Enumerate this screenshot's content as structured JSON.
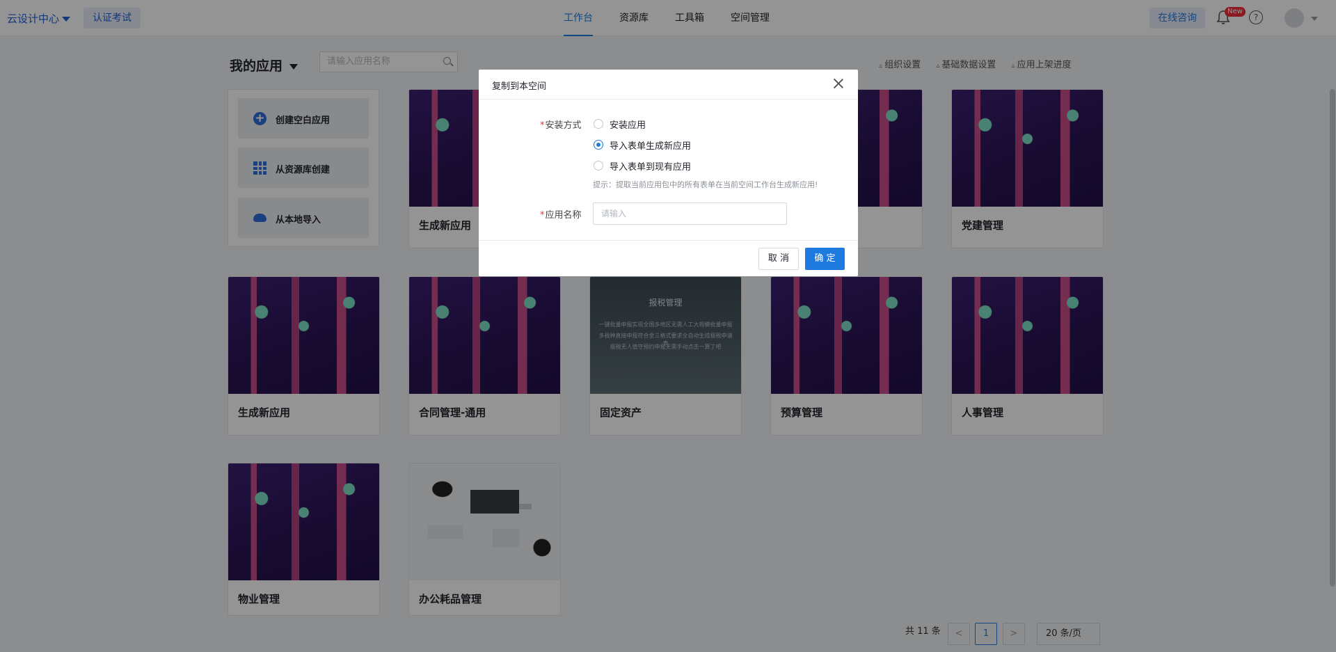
{
  "topbar": {
    "brand": "云设计中心",
    "cert": "认证考试",
    "tabs": [
      "工作台",
      "资源库",
      "工具箱",
      "空间管理"
    ],
    "consult": "在线咨询",
    "new_badge": "New",
    "help": "?"
  },
  "page": {
    "title": "我的应用",
    "search_placeholder": "请输入应用名称",
    "links": [
      "组织设置",
      "基础数据设置",
      "应用上架进度"
    ]
  },
  "create": {
    "blank": "创建空白应用",
    "from_library": "从资源库创建",
    "import_local": "从本地导入"
  },
  "apps": [
    {
      "name": "生成新应用",
      "image": "city"
    },
    {
      "name": "党建管理",
      "image": "city"
    },
    {
      "name": "生成新应用",
      "image": "city"
    },
    {
      "name": "合同管理-通用",
      "image": "city"
    },
    {
      "name": "固定资产",
      "image": "tax"
    },
    {
      "name": "预算管理",
      "image": "city"
    },
    {
      "name": "人事管理",
      "image": "city"
    },
    {
      "name": "物业管理",
      "image": "city"
    },
    {
      "name": "办公耗品管理",
      "image": "desk"
    }
  ],
  "tax_image": {
    "title": "报税管理",
    "line1": "一键批量申报实现全国多地区无需人工大规模批量申报",
    "line2": "多税种直接申报符合金三格式要求全自动生成报税申请表",
    "line3": "报税无人值守预约申报无需手动点击一算了吧"
  },
  "dialog": {
    "title": "复制到本空间",
    "install_label": "安装方式",
    "options": [
      "安装应用",
      "导入表单生成新应用",
      "导入表单到现有应用"
    ],
    "selected_index": 1,
    "hint": "提示：提取当前应用包中的所有表单在当前空间工作台生成新应用!",
    "name_label": "应用名称",
    "name_placeholder": "请输入",
    "cancel": "取 消",
    "ok": "确 定",
    "required_mark": "*"
  },
  "pagination": {
    "total": "共 11 条",
    "prev": "<",
    "current": "1",
    "next": ">",
    "page_size": "20 条/页"
  },
  "colors": {
    "primary": "#1f7ae0",
    "required": "#f0303a"
  }
}
